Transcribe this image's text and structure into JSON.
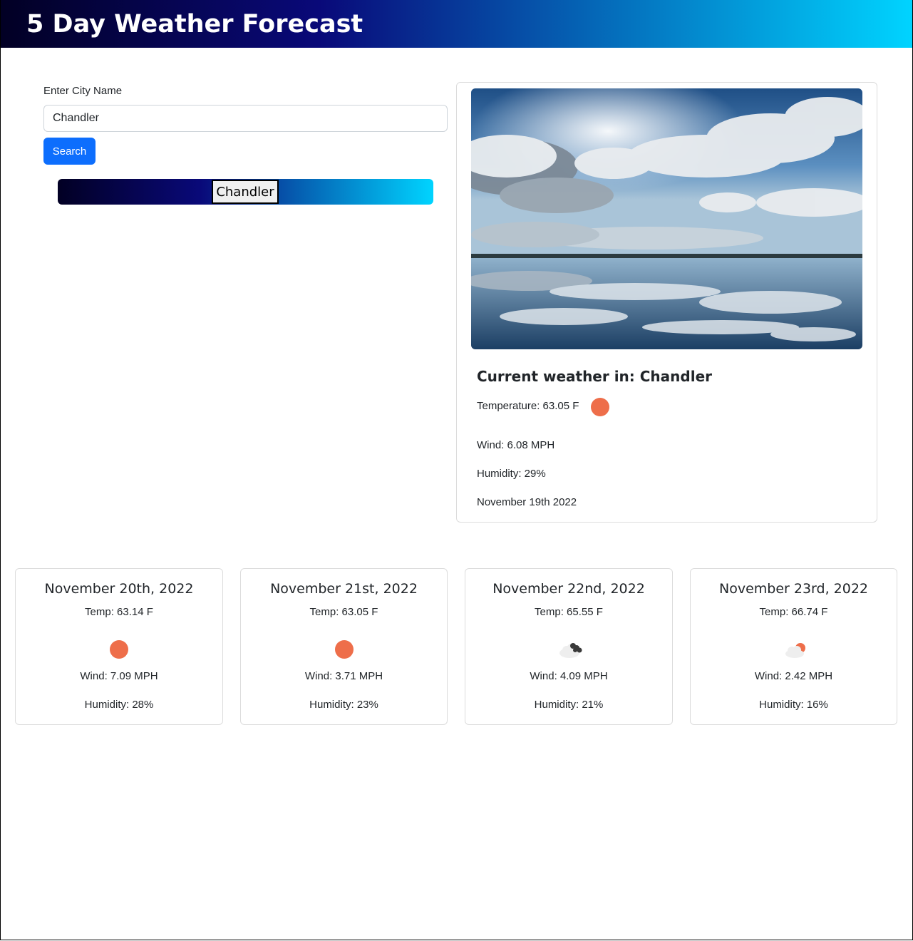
{
  "header": {
    "title": "5 Day Weather Forecast"
  },
  "search": {
    "label": "Enter City Name",
    "value": "Chandler",
    "button_label": "Search"
  },
  "history": {
    "items": [
      {
        "label": "Chandler"
      }
    ]
  },
  "current": {
    "title": "Current weather in: Chandler",
    "temperature": "Temperature: 63.05 F",
    "icon": "sun-icon",
    "wind": "Wind: 6.08 MPH",
    "humidity": "Humidity: 29%",
    "date": "November 19th 2022"
  },
  "forecast": [
    {
      "date": "November 20th, 2022",
      "temp": "Temp: 63.14 F",
      "icon": "sun-icon",
      "wind": "Wind: 7.09 MPH",
      "humidity": "Humidity: 28%"
    },
    {
      "date": "November 21st, 2022",
      "temp": "Temp: 63.05 F",
      "icon": "sun-icon",
      "wind": "Wind: 3.71 MPH",
      "humidity": "Humidity: 23%"
    },
    {
      "date": "November 22nd, 2022",
      "temp": "Temp: 65.55 F",
      "icon": "broken-clouds-icon",
      "wind": "Wind: 4.09 MPH",
      "humidity": "Humidity: 21%"
    },
    {
      "date": "November 23rd, 2022",
      "temp": "Temp: 66.74 F",
      "icon": "partly-cloudy-icon",
      "wind": "Wind: 2.42 MPH",
      "humidity": "Humidity: 16%"
    }
  ],
  "colors": {
    "header_gradient": [
      "#020024",
      "#090979",
      "#00d4ff"
    ],
    "search_button": "#0d6efd",
    "sun": "#ee6e4a"
  }
}
